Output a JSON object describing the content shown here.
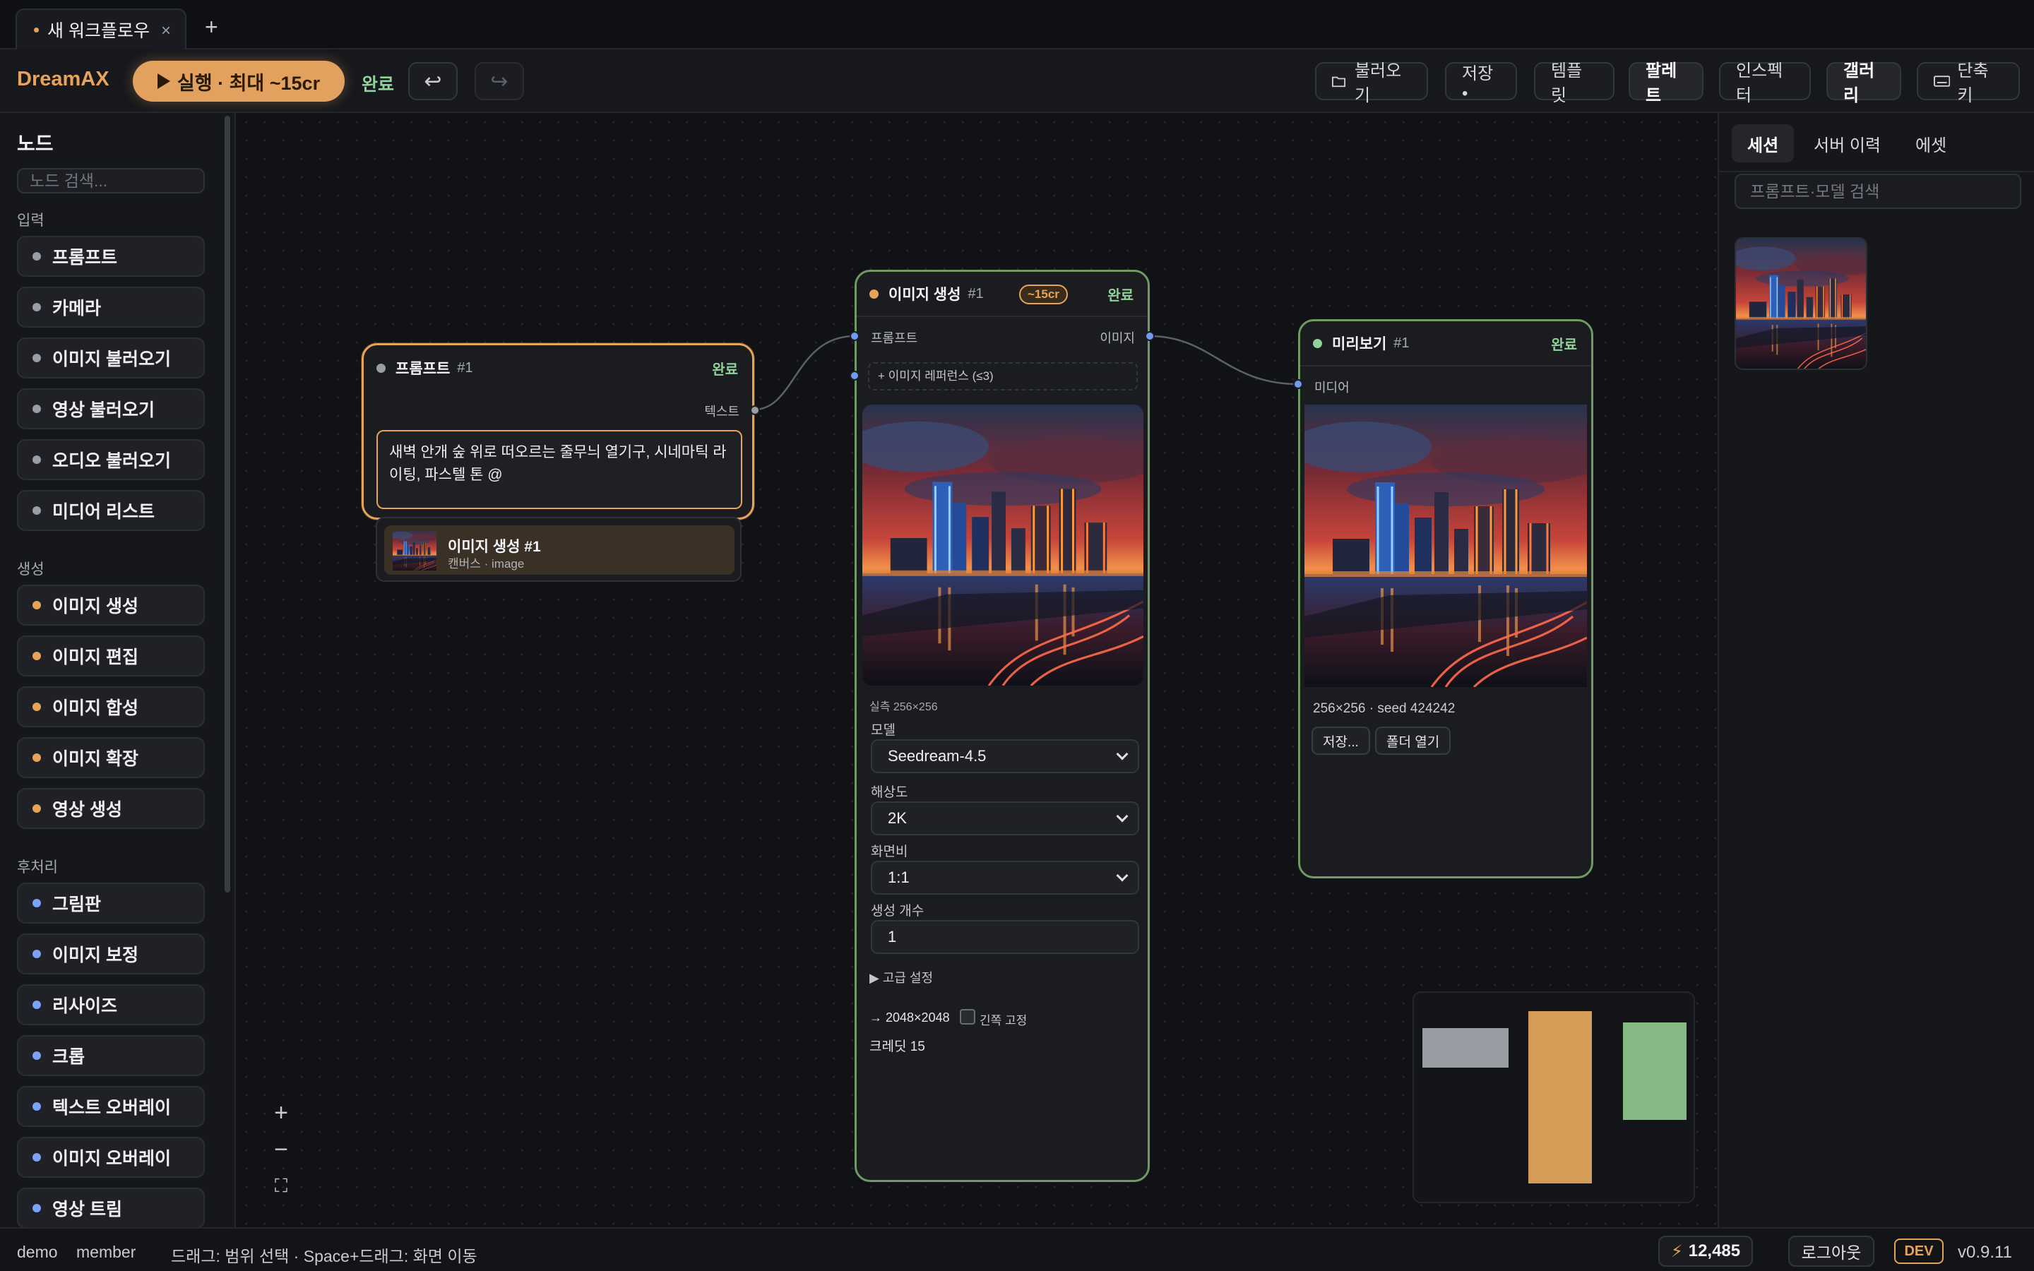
{
  "tab": {
    "title": "새 워크플로우",
    "close": "×",
    "new": "+"
  },
  "toolbar": {
    "brand": "DreamAX",
    "run_label": "실행 · 최대 ~15cr",
    "status": "완료",
    "undo_icon": "↩",
    "redo_icon": "↪",
    "open_label": "불러오기",
    "save_label": "저장 •",
    "template_label": "템플릿",
    "palette_label": "팔레트",
    "inspector_label": "인스펙터",
    "gallery_label": "갤러리",
    "shortcut_label": "단축키"
  },
  "sidebar": {
    "title": "노드",
    "search_placeholder": "노드 검색...",
    "sections": [
      {
        "label": "입력",
        "items": [
          "프롬프트",
          "카메라",
          "이미지 불러오기",
          "영상 불러오기",
          "오디오 불러오기",
          "미디어 리스트"
        ]
      },
      {
        "label": "생성",
        "items": [
          "이미지 생성",
          "이미지 편집",
          "이미지 합성",
          "이미지 확장",
          "영상 생성"
        ]
      },
      {
        "label": "후처리",
        "items": [
          "그림판",
          "이미지 보정",
          "리사이즈",
          "크롭",
          "텍스트 오버레이",
          "이미지 오버레이",
          "영상 트림"
        ]
      }
    ],
    "colors": {
      "input": "#9b9da5",
      "gen": "#e7a357",
      "post": "#7aa2f7"
    }
  },
  "prompt_node": {
    "title": "프롬프트",
    "num": "#1",
    "status": "완료",
    "out_label": "텍스트",
    "text": "새벽 안개 숲 위로 떠오르는 줄무늬 열기구, 시네마틱 라이팅, 파스텔 톤 @",
    "suggest_title": "이미지 생성 #1",
    "suggest_sub": "캔버스 · image"
  },
  "gen_node": {
    "title": "이미지 생성",
    "num": "#1",
    "cost": "~15cr",
    "status": "완료",
    "in_label": "프롬프트",
    "out_label": "이미지",
    "ref_label": "+ 이미지 레퍼런스 (≤3)",
    "actual": "실측 256×256",
    "model_label": "모델",
    "model": "Seedream-4.5",
    "res_label": "해상도",
    "res": "2K",
    "ratio_label": "화면비",
    "ratio": "1:1",
    "count_label": "생성 개수",
    "count": "1",
    "advanced": "▶ 고급 설정",
    "size": "→ 2048×2048",
    "fix_long": "긴쪽 고정",
    "credit": "크레딧 15"
  },
  "preview_node": {
    "title": "미리보기",
    "num": "#1",
    "status": "완료",
    "in_label": "미디어",
    "info": "256×256 · seed 424242",
    "save_btn": "저장...",
    "folder_btn": "폴더 열기"
  },
  "zoom": {
    "in": "+",
    "out": "−",
    "fit": "⛶"
  },
  "right_panel": {
    "tabs": [
      "세션",
      "서버 이력",
      "에셋"
    ],
    "search_placeholder": "프롬프트·모델 검색"
  },
  "statusbar": {
    "user": "demo",
    "role": "member",
    "hint": "드래그: 범위 선택 · Space+드래그: 화면 이동",
    "credits": "12,485",
    "logout": "로그아웃",
    "env": "DEV",
    "version": "v0.9.11"
  },
  "icons": [
    "close-icon",
    "plus-icon",
    "play-icon",
    "undo-icon",
    "redo-icon",
    "folder-icon",
    "keyboard-icon",
    "chevron-down-icon",
    "zoom-in-icon",
    "zoom-out-icon",
    "fit-screen-icon",
    "lightning-icon"
  ]
}
